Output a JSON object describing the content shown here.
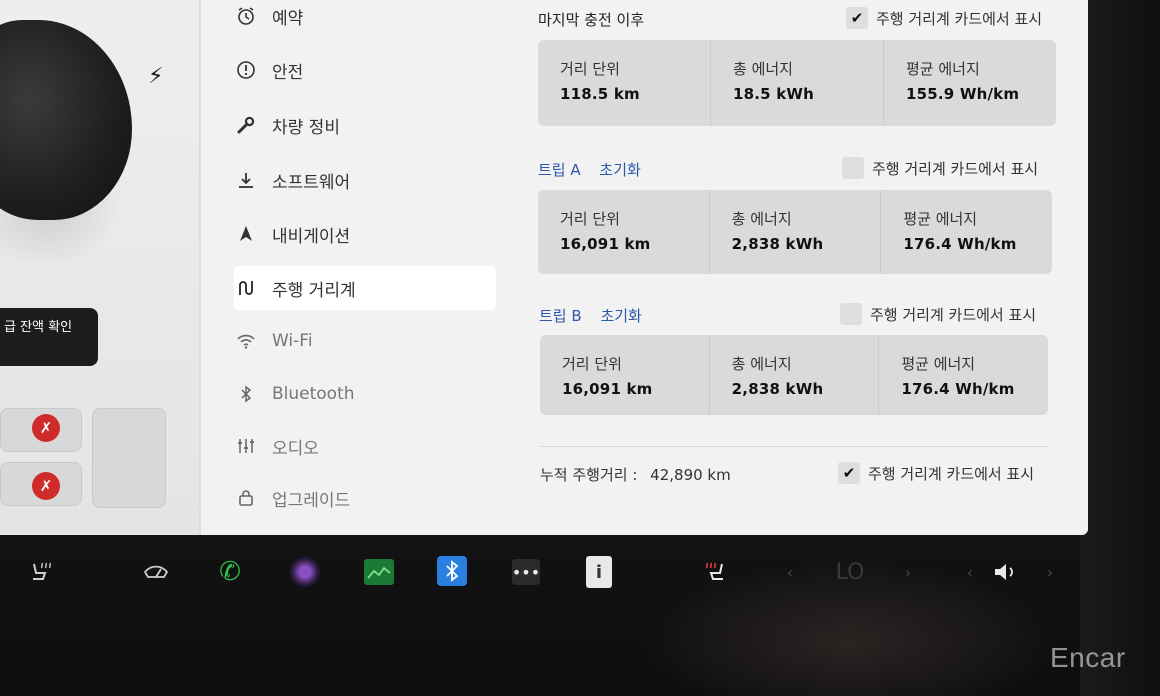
{
  "menu": {
    "items": [
      {
        "label": "예약",
        "icon": "alarm-clock-icon"
      },
      {
        "label": "안전",
        "icon": "alert-circle-icon"
      },
      {
        "label": "차량 정비",
        "icon": "wrench-icon"
      },
      {
        "label": "소프트웨어",
        "icon": "download-icon"
      },
      {
        "label": "내비게이션",
        "icon": "navigation-arrow-icon"
      },
      {
        "label": "주행 거리계",
        "icon": "trip-route-icon"
      },
      {
        "label": "Wi-Fi",
        "icon": "wifi-icon"
      },
      {
        "label": "Bluetooth",
        "icon": "bluetooth-icon"
      },
      {
        "label": "오디오",
        "icon": "equalizer-icon"
      },
      {
        "label": "업그레이드",
        "icon": "lock-bag-icon"
      }
    ],
    "active": "주행 거리계"
  },
  "car_panel": {
    "tooltip": "급 잔액 확인"
  },
  "since_last_charge": {
    "title": "마지막 충전 이후",
    "toggle_label": "주행 거리계 카드에서 표시",
    "toggle_checked": true,
    "stats": [
      {
        "label": "거리 단위",
        "value": "118.5 km"
      },
      {
        "label": "총 에너지",
        "value": "18.5 kWh"
      },
      {
        "label": "평균 에너지",
        "value": "155.9 Wh/km"
      }
    ]
  },
  "trip_a": {
    "title": "트립 A",
    "reset": "초기화",
    "toggle_label": "주행 거리계 카드에서 표시",
    "toggle_checked": false,
    "stats": [
      {
        "label": "거리 단위",
        "value": "16,091 km"
      },
      {
        "label": "총 에너지",
        "value": "2,838 kWh"
      },
      {
        "label": "평균 에너지",
        "value": "176.4 Wh/km"
      }
    ]
  },
  "trip_b": {
    "title": "트립 B",
    "reset": "초기화",
    "toggle_label": "주행 거리계 카드에서 표시",
    "toggle_checked": false,
    "stats": [
      {
        "label": "거리 단위",
        "value": "16,091 km"
      },
      {
        "label": "총 에너지",
        "value": "2,838 kWh"
      },
      {
        "label": "평균 에너지",
        "value": "176.4 Wh/km"
      }
    ]
  },
  "odometer": {
    "label": "누적 주행거리 :",
    "value": "42,890 km",
    "toggle_label": "주행 거리계 카드에서 표시",
    "toggle_checked": true
  },
  "taskbar": {
    "temperature": "LO",
    "icons": [
      "seat-heater-icon",
      "wiper-icon",
      "phone-icon",
      "camera-icon",
      "energy-graph-icon",
      "bluetooth-icon",
      "more-icon",
      "manual-info-icon",
      "seat-heater-passenger-icon",
      "chevron-left-icon",
      "chevron-right-icon",
      "volume-icon"
    ]
  },
  "watermark": "Encar",
  "colors": {
    "screen_bg": "#f2f2f2",
    "card_bg": "#dadada",
    "link_blue": "#2d58a8",
    "phone_green": "#2ec14a",
    "bluetooth_blue": "#2a7fe0",
    "warning_red": "#d02b2b"
  }
}
